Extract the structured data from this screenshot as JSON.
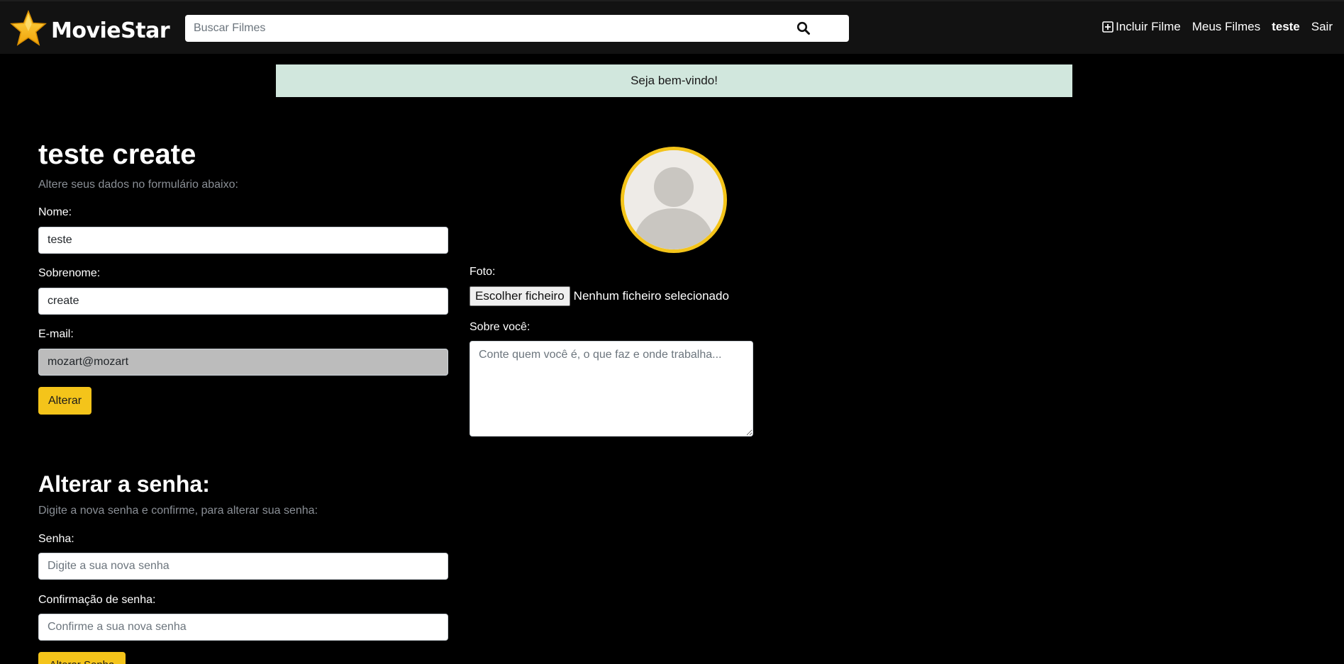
{
  "navbar": {
    "brand": "MovieStar",
    "search_placeholder": "Buscar Filmes",
    "links": {
      "add_movie": "Incluir Filme",
      "my_movies": "Meus Filmes",
      "user": "teste",
      "logout": "Sair"
    }
  },
  "alert": {
    "message": "Seja bem-vindo!"
  },
  "profile": {
    "title": "teste create",
    "subtitle": "Altere seus dados no formulário abaixo:",
    "name_label": "Nome:",
    "name_value": "teste",
    "lastname_label": "Sobrenome:",
    "lastname_value": "create",
    "email_label": "E-mail:",
    "email_value": "mozart@mozart",
    "submit_label": "Alterar"
  },
  "photo": {
    "label": "Foto:",
    "file_button": "Escolher ficheiro",
    "file_status": "Nenhum ficheiro selecionado",
    "bio_label": "Sobre você:",
    "bio_placeholder": "Conte quem você é, o que faz e onde trabalha..."
  },
  "password": {
    "title": "Alterar a senha:",
    "subtitle": "Digite a nova senha e confirme, para alterar sua senha:",
    "password_label": "Senha:",
    "password_placeholder": "Digite a sua nova senha",
    "confirm_label": "Confirmação de senha:",
    "confirm_placeholder": "Confirme a sua nova senha",
    "submit_label": "Alterar Senha"
  },
  "colors": {
    "accent": "#f4c41a",
    "navbar_bg": "#121212",
    "alert_bg": "#d1e7dd"
  }
}
